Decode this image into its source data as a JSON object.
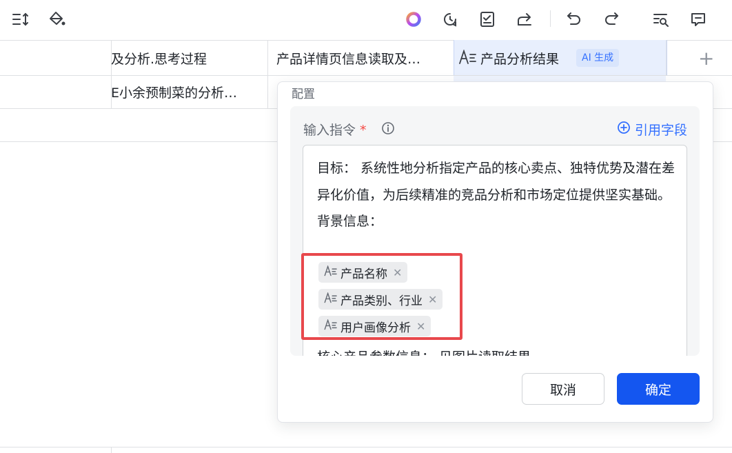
{
  "columns": {
    "col1_header": "及分析.思考过程",
    "col2_header": "产品详情页信息读取及…",
    "col3_header": "产品分析结果",
    "col3_badge": "AI 生成"
  },
  "row1": {
    "col1": "E小余预制菜的分析…"
  },
  "panel": {
    "title": "配置",
    "field_label": "输入指令",
    "required_mark": "*",
    "ref_button": "引用字段",
    "prompt_line1": "目标：  系统性地分析指定产品的核心卖点、独特优势及潜在差异化价值，为后续精准的竞品分析和市场定位提供坚实基础。",
    "prompt_line2": "背景信息：",
    "chips": [
      {
        "label": "产品名称"
      },
      {
        "label": "产品类别、行业"
      },
      {
        "label": "用户画像分析"
      }
    ],
    "prompt_tail": "核心产品参数信息：  见图片读取结果",
    "cancel_label": "取消",
    "ok_label": "确定"
  },
  "icons": {
    "toolbar": [
      "sort-icon",
      "paint-bucket-icon",
      "ai-ring-icon",
      "history-icon",
      "checklist-icon",
      "share-icon",
      "undo-icon",
      "redo-icon",
      "search-list-icon",
      "comment-icon"
    ]
  },
  "colors": {
    "accent": "#1456f0",
    "link": "#3370ff",
    "highlight": "#e8484c"
  }
}
